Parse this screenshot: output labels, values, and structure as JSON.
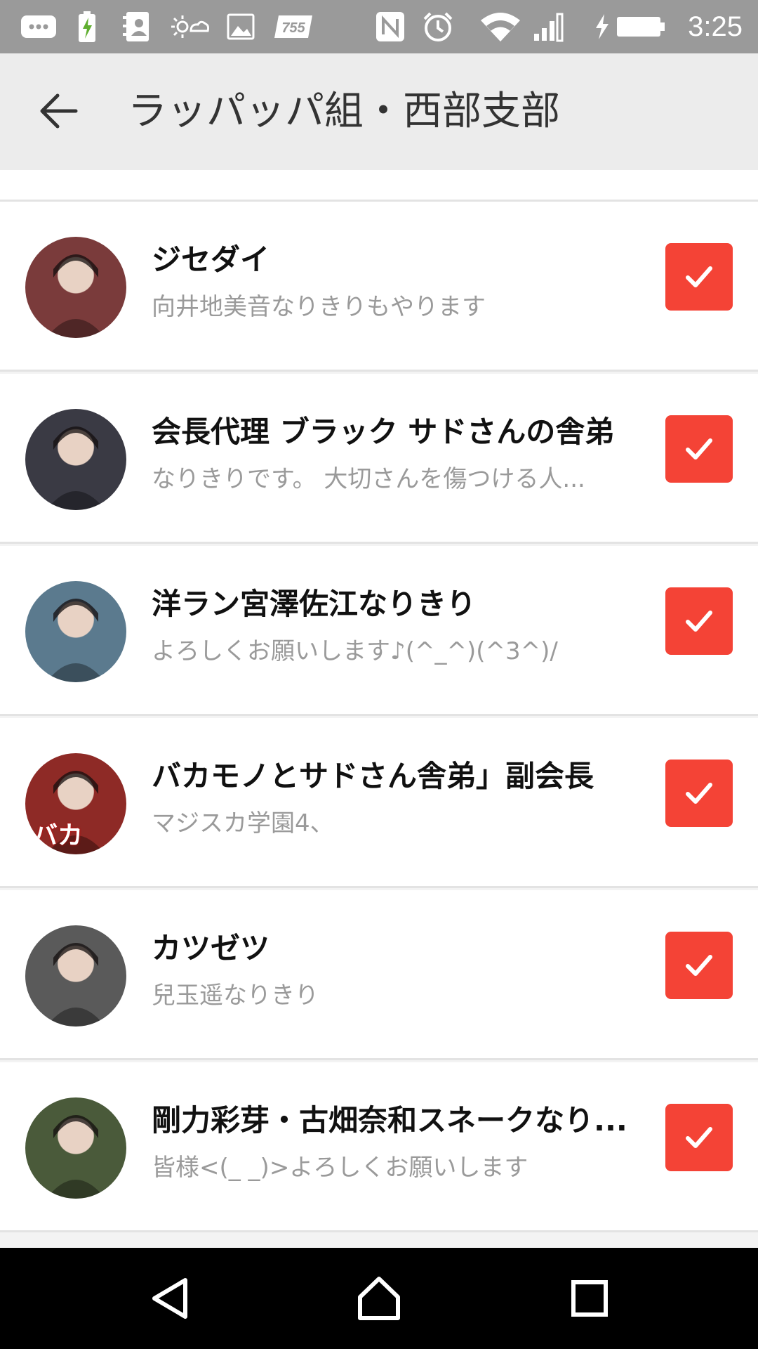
{
  "status_bar": {
    "time": "3:25",
    "icons": [
      "message-icon",
      "battery-charging-icon",
      "contacts-icon",
      "weather-icon",
      "gallery-icon",
      "app-755-icon",
      "nfc-icon",
      "alarm-icon",
      "wifi-icon",
      "signal-icon",
      "battery-icon"
    ],
    "badge_755": "755"
  },
  "app_bar": {
    "title": "ラッパッパ組・西部支部",
    "back_icon": "arrow-back-icon"
  },
  "colors": {
    "checkbox": "#f44336",
    "status_bar": "#9a9a9a",
    "app_bar": "#ececec",
    "desc_text": "#9a9a9a"
  },
  "members": [
    {
      "name": "ジセダイ",
      "description": "向井地美音なりきりもやります",
      "checked": true,
      "avatar_color": "#7a3b3b"
    },
    {
      "name": "会長代理 ブラック サドさんの舎弟",
      "description": "なりきりです。 大切さんを傷つける人...",
      "checked": true,
      "avatar_color": "#3a3a44"
    },
    {
      "name": "洋ラン宮澤佐江なりきり",
      "description": "よろしくお願いします♪(^_^)(^3^)/",
      "checked": true,
      "avatar_color": "#5b7a8e"
    },
    {
      "name": "バカモノとサドさん舎弟」副会長",
      "description": "マジスカ学園4、",
      "checked": true,
      "avatar_color": "#8e2a26",
      "avatar_overlay_text": "バカ"
    },
    {
      "name": "カツゼツ",
      "description": "兒玉遥なりきり",
      "checked": true,
      "avatar_color": "#5a5a5a"
    },
    {
      "name": "剛力彩芽・古畑奈和スネークなり...",
      "description": "皆様<(_ _)>よろしくお願いします",
      "checked": true,
      "avatar_color": "#4a5a3a"
    }
  ],
  "nav_bar": {
    "buttons": [
      "back-triangle-icon",
      "home-icon",
      "recents-icon"
    ]
  }
}
